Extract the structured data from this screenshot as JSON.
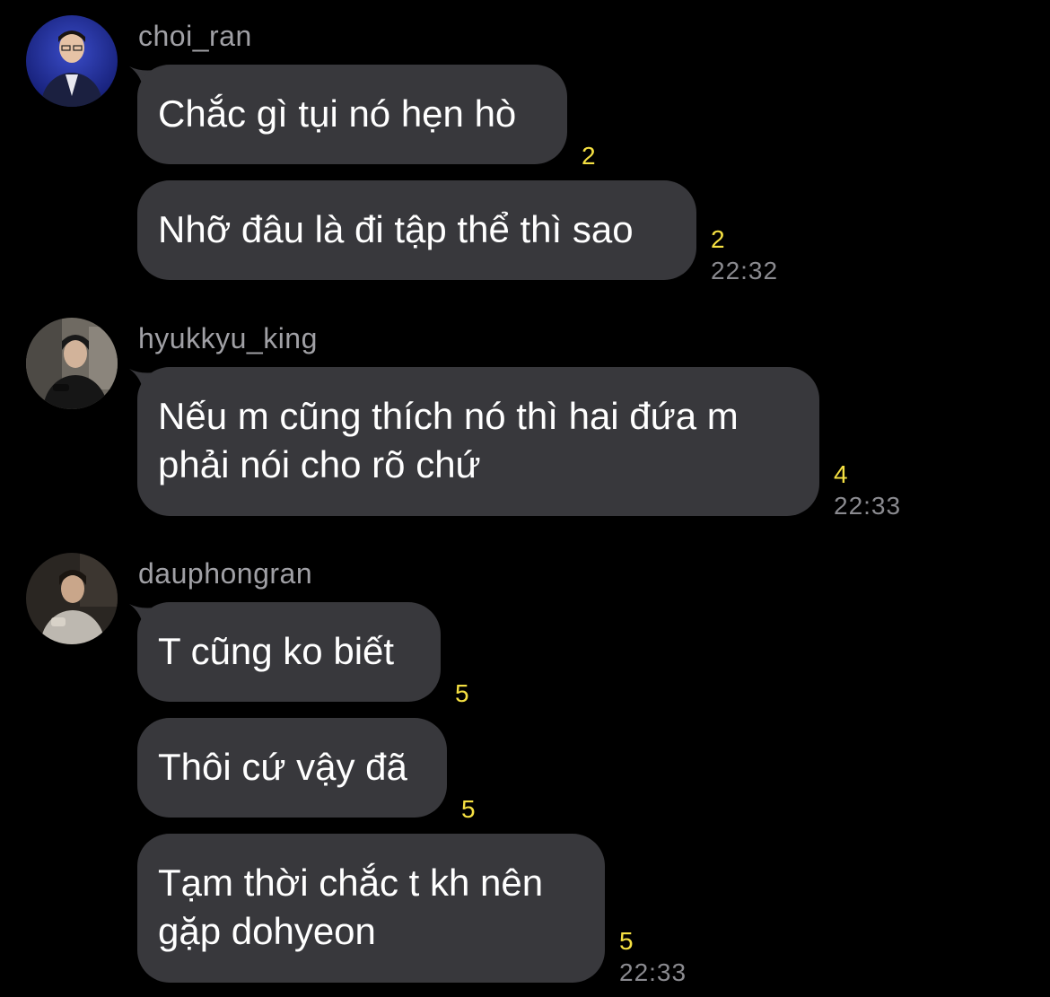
{
  "colors": {
    "background": "#000000",
    "bubble": "#38383c",
    "message_text": "#ffffff",
    "sender_name": "#a0a0a5",
    "read_count": "#f5e042",
    "timestamp": "#8a8a8f"
  },
  "groups": [
    {
      "sender": "choi_ran",
      "avatar_icon": "profile-photo-icon",
      "messages": [
        {
          "text": "Chắc gì tụi nó hẹn hò",
          "read_count": "2",
          "time": ""
        },
        {
          "text": "Nhỡ đâu là đi tập thể thì sao",
          "read_count": "2",
          "time": "22:32"
        }
      ]
    },
    {
      "sender": "hyukkyu_king",
      "avatar_icon": "profile-photo-icon",
      "messages": [
        {
          "text": "Nếu m cũng thích nó thì hai đứa m\nphải nói cho rõ chứ",
          "read_count": "4",
          "time": "22:33"
        }
      ]
    },
    {
      "sender": "dauphongran",
      "avatar_icon": "profile-photo-icon",
      "messages": [
        {
          "text": "T cũng ko biết",
          "read_count": "5",
          "time": ""
        },
        {
          "text": "Thôi cứ vậy đã",
          "read_count": "5",
          "time": ""
        },
        {
          "text": "Tạm thời chắc t kh nên\ngặp dohyeon",
          "read_count": "5",
          "time": "22:33"
        }
      ]
    }
  ]
}
